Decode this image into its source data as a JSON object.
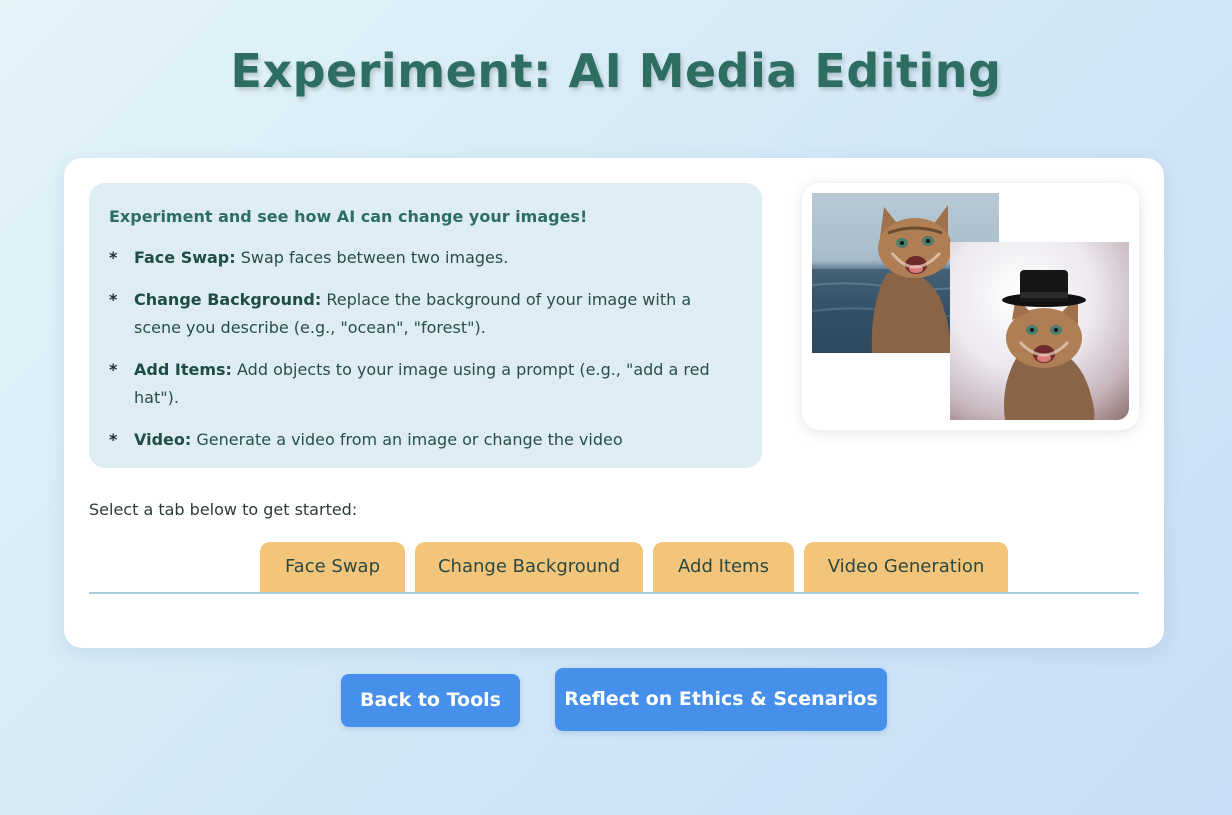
{
  "page": {
    "title": "Experiment: AI Media Editing"
  },
  "info": {
    "intro": "Experiment and see how AI can change your images!",
    "features": [
      {
        "title": "Face Swap:",
        "text": "Swap faces between two images."
      },
      {
        "title": "Change Background:",
        "text": "Replace the background of your image with a scene you describe (e.g., \"ocean\", \"forest\")."
      },
      {
        "title": "Add Items:",
        "text": "Add objects to your image using a prompt (e.g., \"add a red hat\")."
      },
      {
        "title": "Video:",
        "text": "Generate a video from an image or change the video"
      }
    ],
    "bullet": "*"
  },
  "preview": {
    "images": [
      "cat-by-ocean-photo",
      "cat-with-top-hat-photo"
    ]
  },
  "tabs": {
    "prompt": "Select a tab below to get started:",
    "items": [
      "Face Swap",
      "Change Background",
      "Add Items",
      "Video Generation"
    ]
  },
  "actions": {
    "back_label": "Back to Tools",
    "reflect_label": "Reflect on Ethics & Scenarios"
  },
  "colors": {
    "title": "#2e6e62",
    "tab": "#f3c57b",
    "button": "#4690ec",
    "info_box": "#deedf4"
  }
}
